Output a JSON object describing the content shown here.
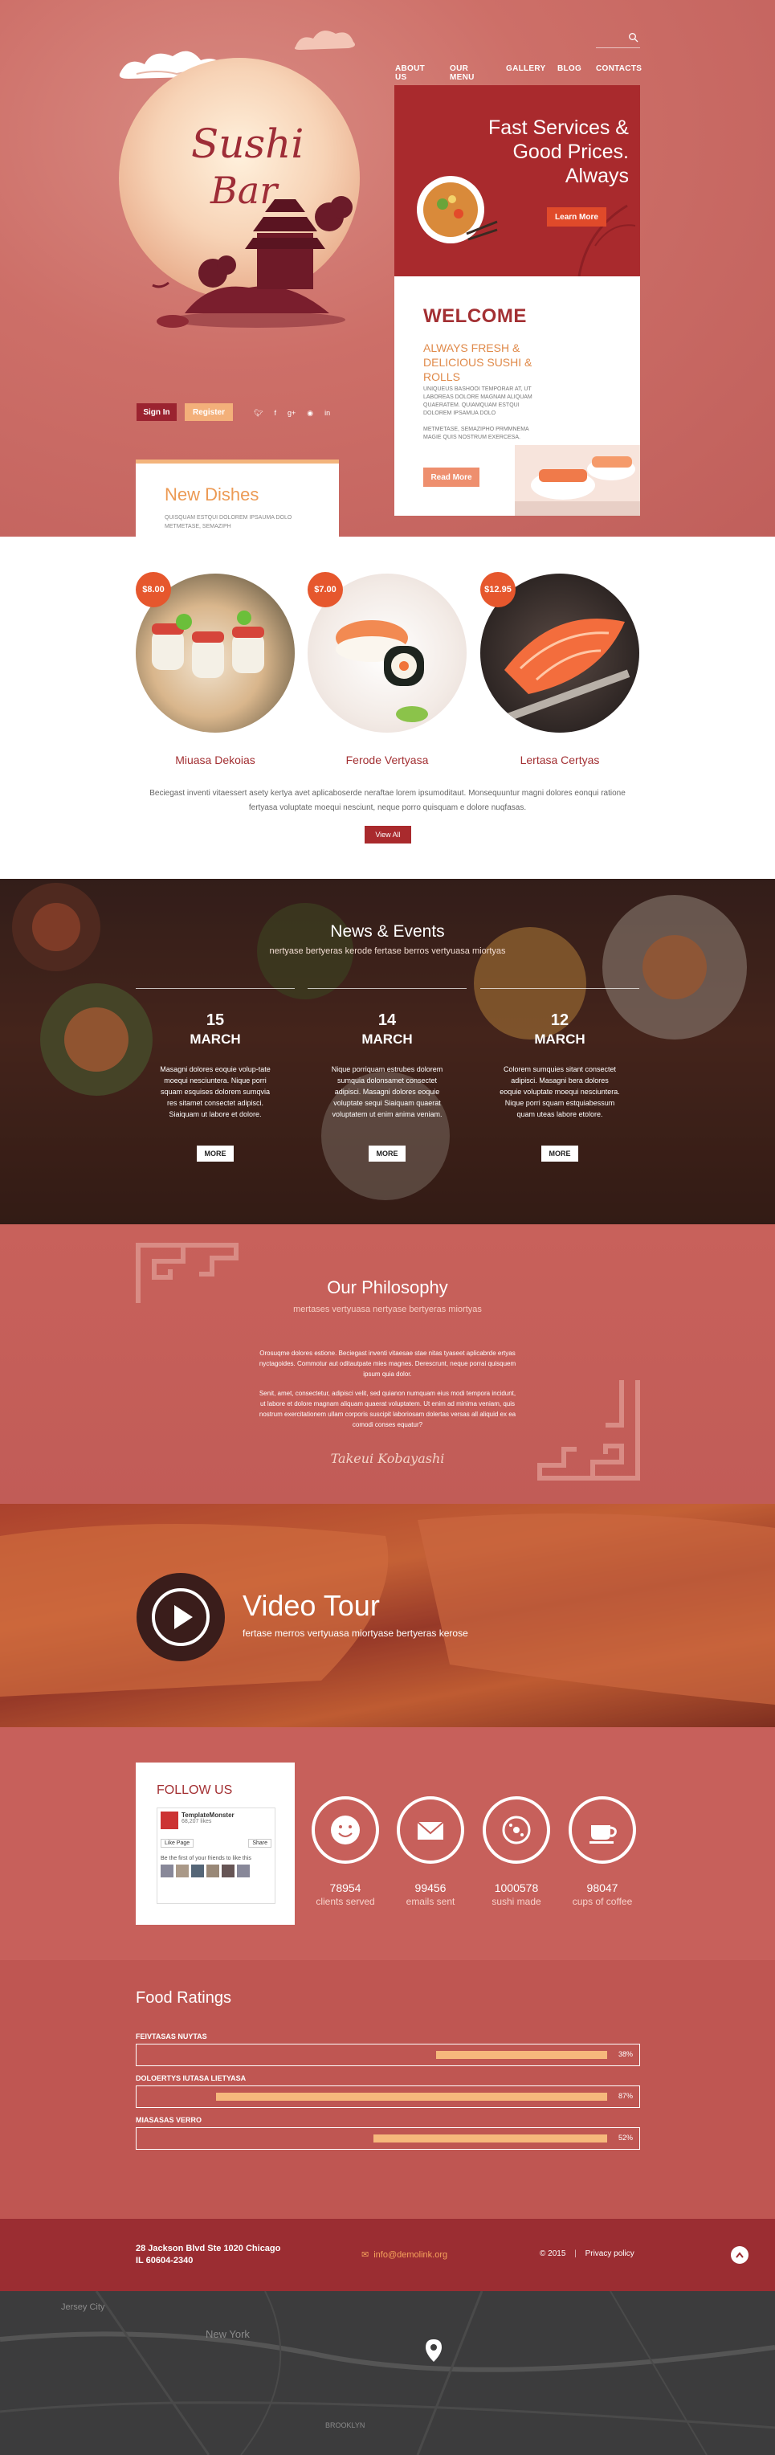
{
  "colors": {
    "primary": "#a92a2d",
    "accent": "#f6b87c",
    "orange": "#e6572d",
    "background": "#c8605c"
  },
  "header": {
    "nav": [
      "ABOUT US",
      "OUR MENU",
      "GALLERY",
      "BLOG",
      "CONTACTS"
    ],
    "logo_line1": "Sushi",
    "logo_line2": "Bar",
    "signin_label": "Sign In",
    "register_label": "Register",
    "social_icons": [
      "twitter-icon",
      "facebook-icon",
      "google-plus-icon",
      "rss-icon",
      "linkedin-icon"
    ]
  },
  "promo": {
    "title_line1": "Fast Services &",
    "title_line2": "Good Prices.",
    "title_line3": "Always",
    "button_label": "Learn More"
  },
  "welcome": {
    "title": "WELCOME",
    "subtitle": "ALWAYS FRESH & DELICIOUS SUSHI & ROLLS",
    "text1": "UNIQUEUS BASHOOI TEMPORAR AT, UT LABOREAS DOLORE MAGNAM ALIQUAM QUAERATEM. QUIAMQUAM ESTQUI DOLOREM IPSAMUA DOLO",
    "text2": "METMETASE, SEMAZIPHO PRMMNEMA MAGIE QUIS NOSTRUM EXERCESA.",
    "button_label": "Read More"
  },
  "new_dishes": {
    "title": "New Dishes",
    "text": "QUISQUAM ESTQUI DOLOREM IPSAUMA DOLO METMETASE, SEMAZIPH"
  },
  "dishes": [
    {
      "price": "$8.00",
      "name": "Miuasa Dekoias"
    },
    {
      "price": "$7.00",
      "name": "Ferode Vertyasa"
    },
    {
      "price": "$12.95",
      "name": "Lertasa Certyas"
    }
  ],
  "dishes_desc": "Beciegast inventi vitaessert asety kertya avet aplicaboserde neraftae lorem ipsumoditaut. Monsequuntur magni dolores eonqui ratione fertyasa voluptate moequi nesciunt, neque porro quisquam e dolore nuqfasas.",
  "dishes_button": "View All",
  "news": {
    "title": "News & Events",
    "subtitle": "nertyase bertyeras kerode fertase berros vertyuasa miortyas",
    "items": [
      {
        "day": "15",
        "month": "MARCH",
        "text": "Masagni dolores eoquie volup-tate moequi nesciuntera. Nique porri squam esquises dolorem sumqvia res sitamet consectet adipisci. Siaiquam ut labore et dolore."
      },
      {
        "day": "14",
        "month": "MARCH",
        "text": "Nique porriquam estrubes dolorem sumquia dolonsamet consectet adipisci. Masagni dolores eoquie voluptate sequi Siaiquam quaerat voluptatem ut enim anima veniam."
      },
      {
        "day": "12",
        "month": "MARCH",
        "text": "Colorem sumquies sitant consectet adipisci. Masagni bera dolores eoquie voluptate moequi nesciuntera. Nique porri squam estquiabessum quam uteas labore etolore."
      }
    ],
    "more_label": "MORE"
  },
  "philosophy": {
    "title": "Our Philosophy",
    "subtitle": "mertases vertyuasa nertyase bertyeras miortyas",
    "para1": "Orosuqme dolores estione. Beciegast inventi vitaesae stae nitas tyaseet aplicabrde ertyas nyctagoides. Commotur aut oditautpate mies magnes. Derescrunt, neque porrai quisquem ipsum quia dolor.",
    "para2": "Senit, amet, consectetur, adipisci velit, sed quianon numquam eius modi tempora incidunt, ut labore et dolore magnam aliquam quaerat voluptatem. Ut enim ad minima veniam, quis nostrum exercitationem ullam corporis suscipit laboriosam dolertas versas all aliquid ex ea comodi conses equatur?",
    "signature": "Takeui Kobayashi"
  },
  "video": {
    "title": "Video Tour",
    "subtitle": "fertase merros vertyuasa miortyase bertyeras kerose"
  },
  "follow": {
    "title": "FOLLOW US",
    "fb_page": "TemplateMonster",
    "fb_likes": "68,207 likes",
    "fb_like_btn": "Like Page",
    "fb_share_btn": "Share",
    "fb_friends": "Be the first of your friends to like this"
  },
  "stats": [
    {
      "value": "78954",
      "label": "clients served",
      "icon": "smile-icon"
    },
    {
      "value": "99456",
      "label": "emails sent",
      "icon": "envelope-icon"
    },
    {
      "value": "1000578",
      "label": "sushi made",
      "icon": "sushi-icon"
    },
    {
      "value": "98047",
      "label": "cups of coffee",
      "icon": "coffee-icon"
    }
  ],
  "ratings": {
    "title": "Food Ratings",
    "items": [
      {
        "label": "FEIVTASAS NUYTAS",
        "percent": "38%",
        "value": 0.38
      },
      {
        "label": "DOLOERTYS IUTASA LIETYASA",
        "percent": "87%",
        "value": 0.87
      },
      {
        "label": "MIASASAS VERRO",
        "percent": "52%",
        "value": 0.52
      }
    ]
  },
  "footer": {
    "address_line1": "28 Jackson Blvd Ste 1020 Chicago",
    "address_line2": "IL 60604-2340",
    "email": "info@demolink.org",
    "copyright": "© 2015",
    "privacy": "Privacy policy"
  },
  "map": {
    "labels": [
      "Jersey City",
      "New York",
      "BROOKLYN"
    ]
  }
}
